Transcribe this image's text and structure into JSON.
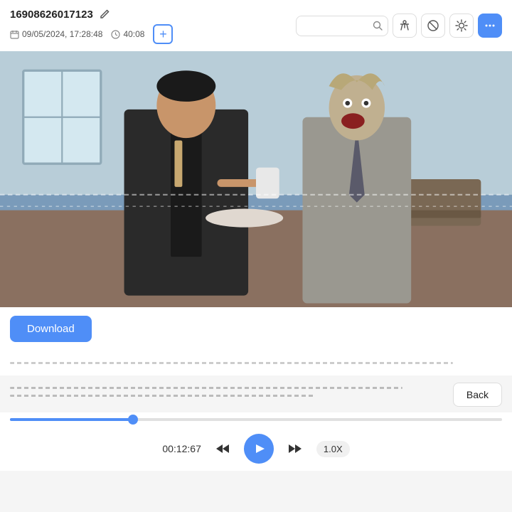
{
  "header": {
    "record_id": "16908626017123",
    "date": "09/05/2024, 17:28:48",
    "duration": "40:08",
    "edit_icon": "✏",
    "add_label": "+",
    "search_placeholder": "",
    "icons": {
      "pen": "✏️",
      "accessibility": "♿",
      "block": "🚫",
      "brightness": "☀"
    },
    "more_btn": "⋯"
  },
  "video": {
    "dotted_lines": true
  },
  "download": {
    "label": "Download"
  },
  "redacted": {
    "line1": "................................................................",
    "line2": "................................................................",
    "line3": "................................................................"
  },
  "back_btn": {
    "label": "Back"
  },
  "progress": {
    "fill_pct": 25
  },
  "playback": {
    "time": "00:12:67",
    "speed": "1.0X"
  }
}
